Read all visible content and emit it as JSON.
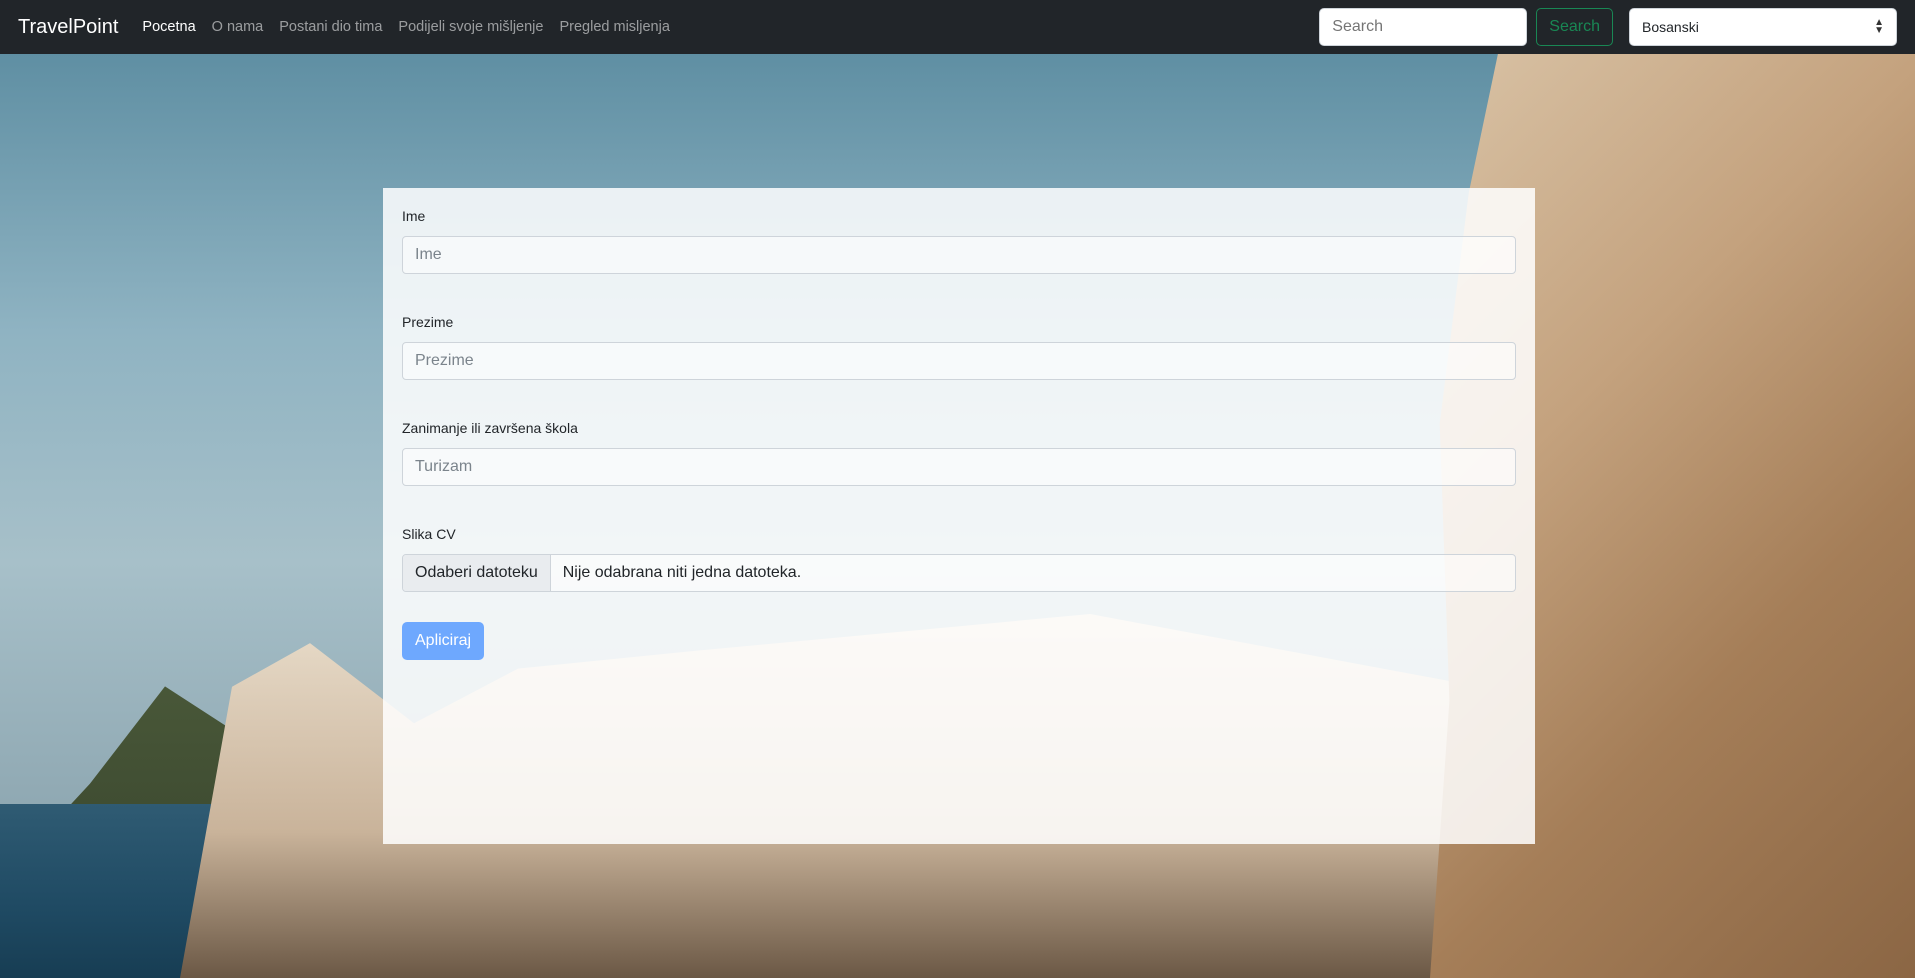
{
  "navbar": {
    "brand": "TravelPoint",
    "links": [
      {
        "label": "Pocetna",
        "active": true
      },
      {
        "label": "O nama"
      },
      {
        "label": "Postani dio tima"
      },
      {
        "label": "Podijeli svoje mišljenje"
      },
      {
        "label": "Pregled misljenja"
      }
    ],
    "search_placeholder": "Search",
    "search_button": "Search",
    "language_selected": "Bosanski"
  },
  "form": {
    "first_name": {
      "label": "Ime",
      "placeholder": "Ime"
    },
    "last_name": {
      "label": "Prezime",
      "placeholder": "Prezime"
    },
    "occupation": {
      "label": "Zanimanje ili završena škola",
      "placeholder": "Turizam"
    },
    "cv": {
      "label": "Slika CV",
      "button": "Odaberi datoteku",
      "status": "Nije odabrana niti jedna datoteka."
    },
    "submit": "Apliciraj"
  },
  "colors": {
    "navbar_bg": "#212529",
    "search_outline": "#198754",
    "submit_bg": "#6ea8fe"
  }
}
